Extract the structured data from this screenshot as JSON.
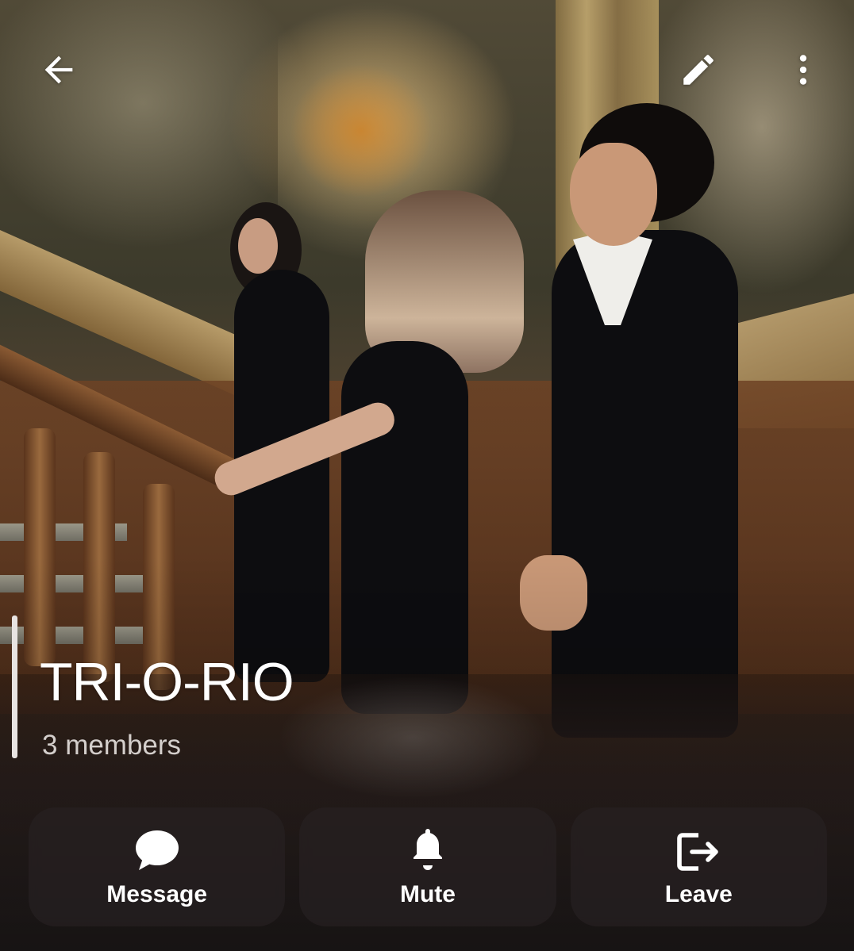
{
  "header": {
    "back_icon": "arrow-left-icon",
    "edit_icon": "pencil-icon",
    "more_icon": "more-vertical-icon"
  },
  "group": {
    "title": "TRI-O-RIO",
    "members": "3 members"
  },
  "actions": [
    {
      "label": "Message",
      "icon": "chat-bubble-icon"
    },
    {
      "label": "Mute",
      "icon": "bell-icon"
    },
    {
      "label": "Leave",
      "icon": "leave-icon"
    }
  ],
  "colors": {
    "text_primary": "#ffffff",
    "text_secondary": "#d4cfcc",
    "button_bg": "rgba(40,34,36,0.62)"
  }
}
